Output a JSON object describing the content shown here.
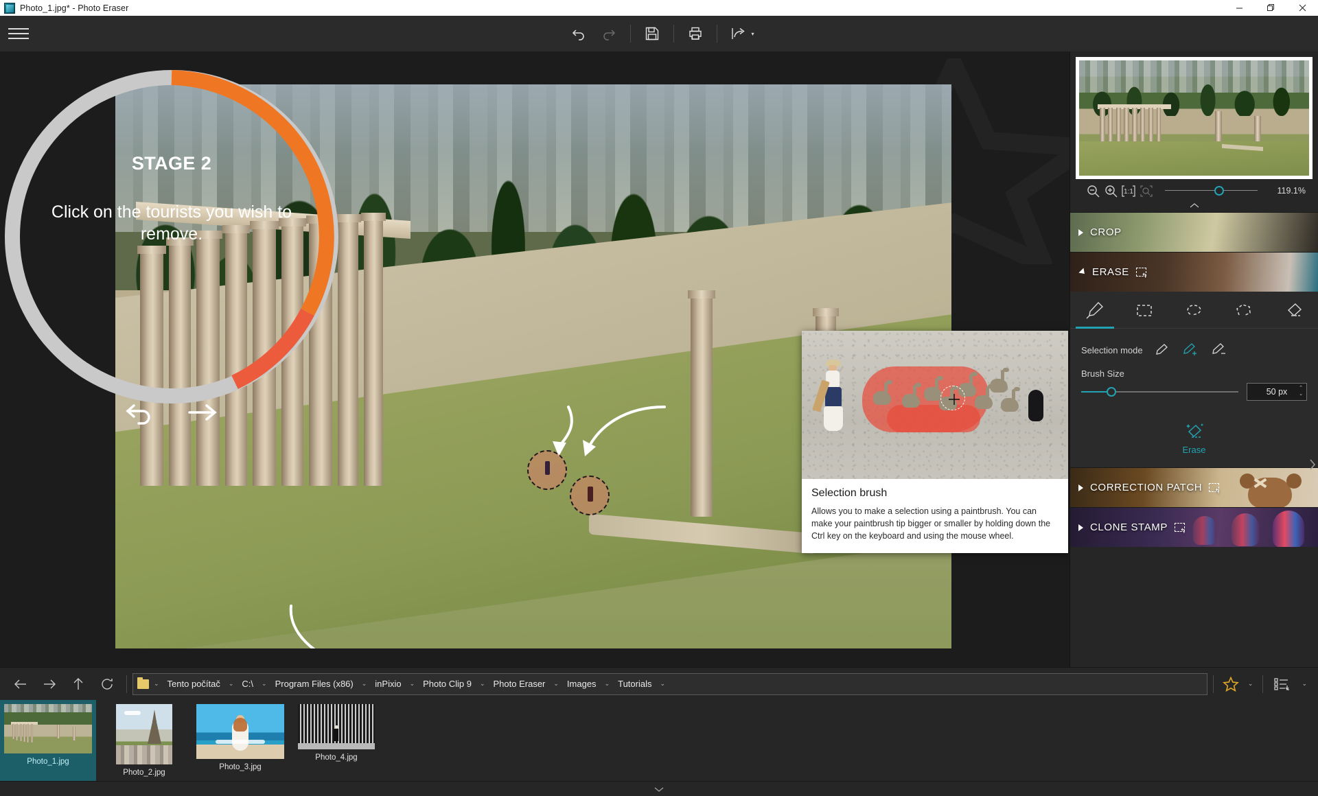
{
  "window": {
    "title": "Photo_1.jpg* - Photo Eraser",
    "app_icon": "photo-eraser-icon",
    "minimize": "—",
    "restore": "❐",
    "close": "✕"
  },
  "toolbar": {
    "menu_icon": "hamburger-menu-icon",
    "undo_label": "Undo",
    "redo_label": "Redo",
    "save_label": "Save",
    "print_label": "Print",
    "share_label": "Share",
    "share_caret": "▾"
  },
  "overlay": {
    "stage_label": "STAGE 2",
    "message": "Click on the tourists you wish to remove.",
    "back_icon": "arrow-back-icon",
    "next_icon": "arrow-forward-icon",
    "ring_progress_color": "#ef7622",
    "ring_accent_color": "#eb5b3c",
    "ring_track_color": "#c9c9c9"
  },
  "tooltip": {
    "title": "Selection brush",
    "description": "Allows you to make a selection using a paintbrush. You can make your paintbrush tip bigger or smaller by holding down the Ctrl key on the keyboard and using the mouse wheel.",
    "mask_color": "#e74c3c"
  },
  "navigator": {
    "zoom_out_icon": "zoom-out-icon",
    "zoom_in_icon": "zoom-in-icon",
    "actual_size_icon": "one-to-one-icon",
    "fit_screen_icon": "fit-to-screen-icon",
    "zoom_value": "119.1%",
    "collapse_icon": "chevron-up-icon",
    "accent": "#22a3b3"
  },
  "panel": {
    "sections": [
      {
        "id": "crop",
        "label": "CROP",
        "expanded": false,
        "badge_icon": "selection-tool-icon"
      },
      {
        "id": "erase",
        "label": "ERASE",
        "expanded": true,
        "badge_icon": "selection-tool-icon"
      },
      {
        "id": "correction-patch",
        "label": "CORRECTION PATCH",
        "expanded": false,
        "badge_icon": "selection-tool-icon"
      },
      {
        "id": "clone-stamp",
        "label": "CLONE STAMP",
        "expanded": false,
        "badge_icon": "selection-tool-icon"
      }
    ],
    "erase": {
      "tools": [
        {
          "id": "selection-brush",
          "name": "brush-tool-icon",
          "active": true
        },
        {
          "id": "rectangle-select",
          "name": "rectangle-marquee-icon",
          "active": false
        },
        {
          "id": "lasso-select",
          "name": "lasso-icon",
          "active": false
        },
        {
          "id": "polygon-lasso",
          "name": "polygon-lasso-icon",
          "active": false
        },
        {
          "id": "eraser",
          "name": "eraser-icon",
          "active": false
        }
      ],
      "selection_mode_label": "Selection mode",
      "modes": [
        {
          "id": "replace",
          "name": "brush-replace-icon",
          "active": false
        },
        {
          "id": "add",
          "name": "brush-add-icon",
          "active": true
        },
        {
          "id": "subtract",
          "name": "brush-subtract-icon",
          "active": false
        }
      ],
      "brush_size_label": "Brush Size",
      "brush_size_value": "50 px",
      "erase_button_label": "Erase",
      "erase_button_icon": "magic-eraser-icon"
    },
    "collapse_icon": "chevron-right-icon"
  },
  "browser": {
    "back_icon": "arrow-left-icon",
    "forward_icon": "arrow-right-icon",
    "up_icon": "arrow-up-icon",
    "refresh_icon": "refresh-icon",
    "folder_icon": "folder-icon",
    "breadcrumbs": [
      "Tento počítač",
      "C:\\",
      "Program Files (x86)",
      "inPixio",
      "Photo Clip 9",
      "Photo Eraser",
      "Images",
      "Tutorials"
    ],
    "favorites_icon": "star-icon",
    "view_options_icon": "sort-list-icon",
    "caret": "⌄"
  },
  "filmstrip": {
    "items": [
      {
        "name": "Photo_1.jpg",
        "selected": true,
        "thumb": "athens-temple"
      },
      {
        "name": "Photo_2.jpg",
        "selected": false,
        "thumb": "eiffel-tower"
      },
      {
        "name": "Photo_3.jpg",
        "selected": false,
        "thumb": "beach-woman"
      },
      {
        "name": "Photo_4.jpg",
        "selected": false,
        "thumb": "striped-wall"
      }
    ],
    "expand_icon": "chevron-down-icon"
  }
}
